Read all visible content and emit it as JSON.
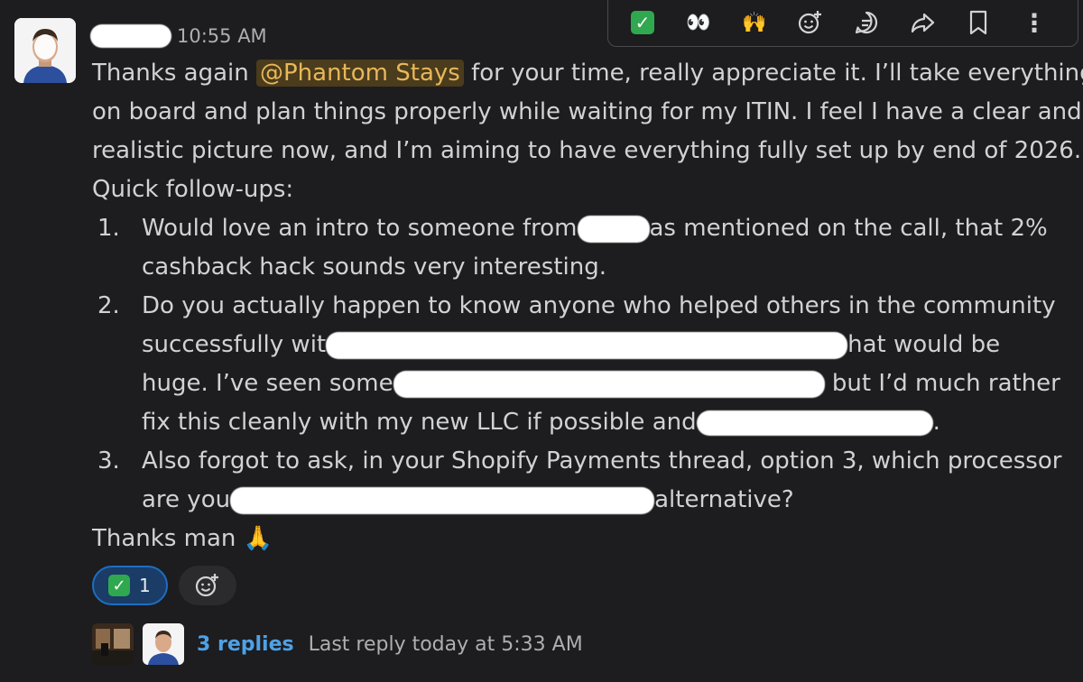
{
  "header": {
    "timestamp": "10:55 AM"
  },
  "toolbar": {
    "items": [
      "check-mark-emoji",
      "eyes-emoji",
      "raised-hands-emoji",
      "add-reaction-icon",
      "reply-in-thread-icon",
      "share-icon",
      "bookmark-icon",
      "more-actions-icon"
    ],
    "eyes": "👀",
    "raised_hands": "🙌",
    "check": "✓",
    "more": "⋮"
  },
  "message": {
    "l1_pre": "Thanks again ",
    "mention": "@Phantom Stays",
    "l1_post": " for your time, really appreciate it. I’ll take everything",
    "l2": "on board and plan things properly while waiting for my ITIN. I feel I have a clear and",
    "l3": "realistic picture now, and I’m aiming to have everything fully set up by end of 2026.",
    "l4": "Quick follow-ups:",
    "item1_num": "1.",
    "item1_a": "Would love an intro to someone from",
    "item1_b": "as mentioned on the call, that 2%",
    "item1_c": "cashback hack sounds very interesting.",
    "item2_num": "2.",
    "item2_a": "Do you actually happen to know anyone who helped others in the community",
    "item2_b": "successfully wit",
    "item2_c": "hat would be",
    "item2_d": "huge. I’ve seen some",
    "item2_e": " but I’d much rather",
    "item2_f": "fix this cleanly with my new LLC if possible and",
    "item2_g": ".",
    "item3_num": "3.",
    "item3_a": "Also forgot to ask, in your Shopify Payments thread, option 3, which processor",
    "item3_b": "are you",
    "item3_c": "alternative?",
    "closing": "Thanks man ",
    "closing_emoji": "🙏"
  },
  "reactions": {
    "check_emoji": "✓",
    "check_count": "1"
  },
  "thread": {
    "replies_label": "3 replies",
    "last_reply": "Last reply today at 5:33 AM"
  },
  "colors": {
    "background": "#1d1c1f",
    "text": "#d1d2d3",
    "mention_bg": "#4a3c1c",
    "mention_text": "#e8b75a",
    "link": "#4ea1e6",
    "reaction_bg": "#1a3c66",
    "reaction_border": "#1d6ec2",
    "check_green": "#2fa84f"
  }
}
